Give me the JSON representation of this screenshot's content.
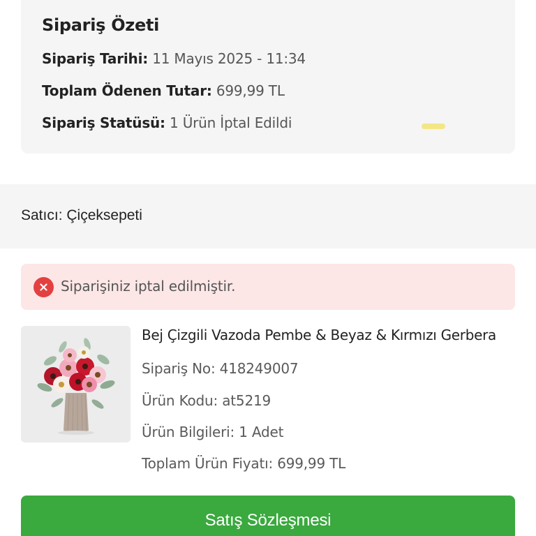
{
  "order_summary": {
    "title": "Sipariş Özeti",
    "date_label": "Sipariş Tarihi:",
    "date_value": "11 Mayıs 2025 - 11:34",
    "total_label": "Toplam Ödenen Tutar:",
    "total_value": "699,99 TL",
    "status_label": "Sipariş Statüsü:",
    "status_value": "1 Ürün İptal Edildi"
  },
  "seller": {
    "label": "Satıcı:",
    "name": "Çiçeksepeti"
  },
  "cancel_alert": {
    "icon": "close-circle-icon",
    "text": "Siparişiniz iptal edilmiştir.",
    "color": "#e34141",
    "background": "#fde6e6"
  },
  "product": {
    "name": "Bej Çizgili Vazoda Pembe & Beyaz & Kırmızı Gerbera",
    "order_no_label": "Sipariş No:",
    "order_no": "418249007",
    "code_label": "Ürün Kodu:",
    "code": "at5219",
    "info_label": "Ürün Bilgileri:",
    "info": "1 Adet",
    "price_label": "Toplam Ürün Fiyatı:",
    "price": "699,99 TL"
  },
  "contract_button": {
    "label": "Satış Sözleşmesi",
    "color": "#3aa93e"
  }
}
